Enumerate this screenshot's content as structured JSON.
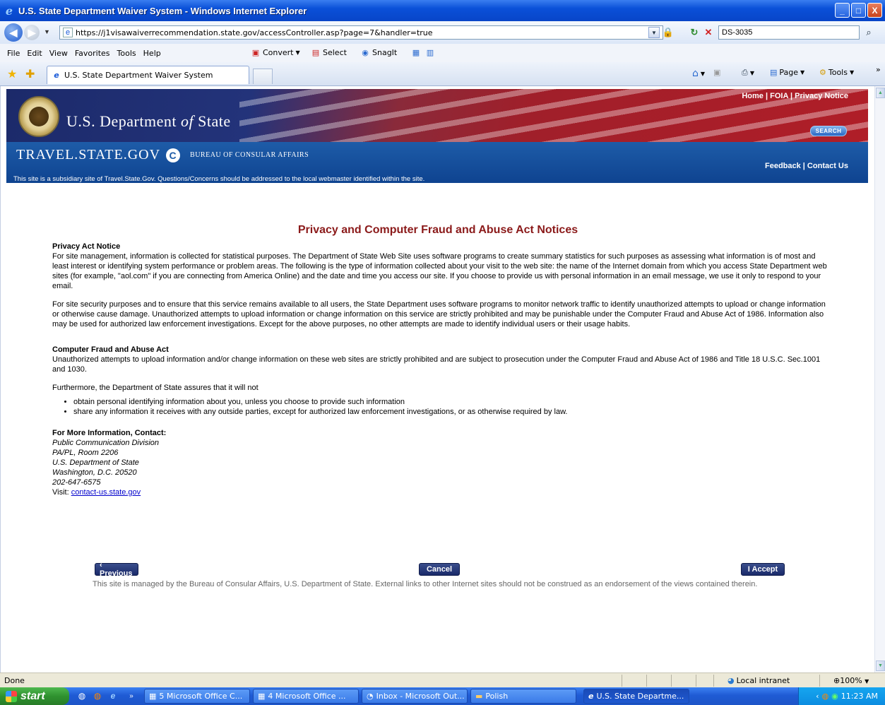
{
  "window": {
    "title": "U.S. State Department Waiver System - Windows Internet Explorer",
    "minimize": "_",
    "maximize": "□",
    "close": "X"
  },
  "address": {
    "url": "https://j1visawaiverrecommendation.state.gov/accessController.asp?page=7&handler=true",
    "search_value": "DS-3035"
  },
  "menu": {
    "items": [
      "File",
      "Edit",
      "View",
      "Favorites",
      "Tools",
      "Help"
    ],
    "convert": "Convert",
    "select": "Select",
    "snagit": "SnagIt"
  },
  "tabs": {
    "active": "U.S. State Department Waiver System",
    "page": "Page",
    "tools": "Tools"
  },
  "site": {
    "top_links": "Home | FOIA | Privacy Notice",
    "dept_prefix": "U.S. Department ",
    "dept_of": "of",
    "dept_suffix": " State",
    "search_btn": "SEARCH",
    "travel": "TRAVEL.STATE.GOV",
    "bureau": "BUREAU OF CONSULAR AFFAIRS",
    "feedback_links": "Feedback | Contact Us",
    "subsidiary": "This site is a subsidiary site of Travel.State.Gov. Questions/Concerns should be addressed to the local webmaster identified within the site."
  },
  "page": {
    "heading": "Privacy and Computer Fraud and Abuse Act Notices",
    "privacy_title": "Privacy Act Notice",
    "privacy_p1": "For site management, information is collected for statistical purposes. The Department of State Web Site uses software programs to create summary statistics for such purposes as assessing what information is of most and least interest or identifying system performance or problem areas. The following is the type of information collected about your visit to the web site: the name of the Internet domain from which you access State Department web sites (for example, \"aol.com\" if you are connecting from America Online) and the date and time you access our site. If you choose to provide us with personal information in an email message, we use it only to respond to your email.",
    "privacy_p2": "For site security purposes and to ensure that this service remains available to all users, the State Department uses software programs to monitor network traffic to identify unauthorized attempts to upload or change information or otherwise cause damage. Unauthorized attempts to upload information or change information on this service are strictly prohibited and may be punishable under the Computer Fraud and Abuse Act of 1986. Information also may be used for authorized law enforcement investigations. Except for the above purposes, no other attempts are made to identify individual users or their usage habits.",
    "cfaa_title": "Computer Fraud and Abuse Act",
    "cfaa_p1": "Unauthorized attempts to upload information and/or change information on these web sites are strictly prohibited and are subject to prosecution under the Computer Fraud and Abuse Act of 1986 and Title 18 U.S.C. Sec.1001 and 1030.",
    "cfaa_p2": "Furthermore, the Department of State assures that it will not",
    "bullets": [
      "obtain personal identifying information about you, unless you choose to provide such information",
      "share any information it receives with any outside parties, except for authorized law enforcement investigations, or as otherwise required by law."
    ],
    "contact_title": "For More Information, Contact:",
    "contact_lines": [
      "Public Communication Division",
      "PA/PL, Room 2206",
      "U.S. Department of State",
      "Washington, D.C. 20520",
      "202-647-6575"
    ],
    "visit_label": "Visit: ",
    "visit_link": "contact-us.state.gov",
    "btn_previous": "‹ Previous",
    "btn_cancel": "Cancel",
    "btn_accept": "I Accept",
    "footer": "This site is managed by the Bureau of Consular Affairs, U.S. Department of State. External links to other Internet sites should not be construed as an endorsement of the views contained therein."
  },
  "status": {
    "done": "Done",
    "zone": "Local intranet",
    "zoom": "100%"
  },
  "taskbar": {
    "start": "start",
    "tasks": [
      "5 Microsoft Office C...",
      "4 Microsoft Office ...",
      "Inbox - Microsoft Out...",
      "Polish",
      "U.S. State Departme..."
    ],
    "clock": "11:23 AM"
  }
}
